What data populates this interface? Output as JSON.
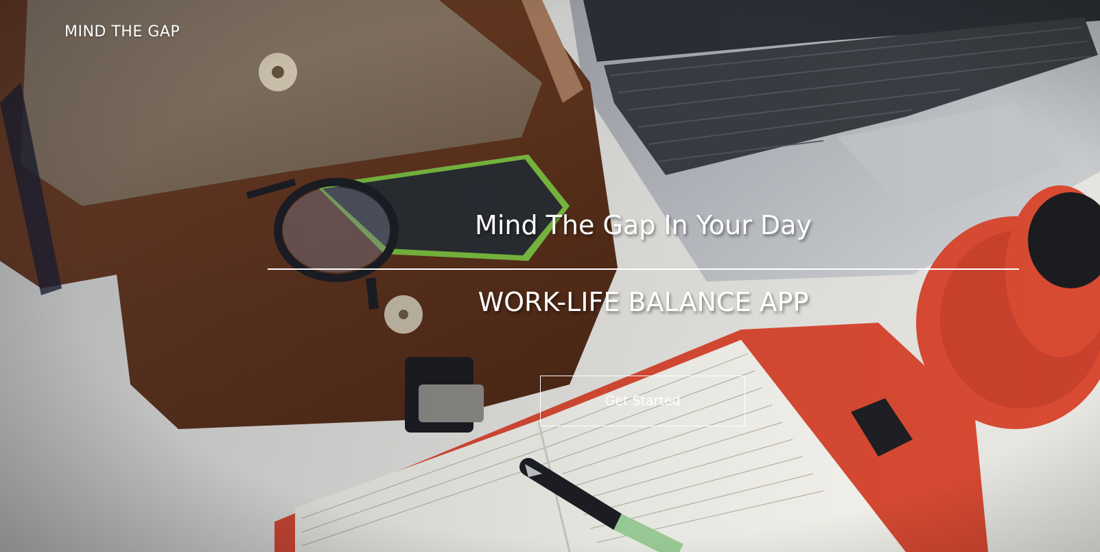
{
  "brand": {
    "name": "MIND THE GAP"
  },
  "hero": {
    "headline": "Mind The Gap In Your Day",
    "subheadline": "WORK-LIFE BALANCE APP",
    "cta_label": "Get Started"
  },
  "colors": {
    "text": "#ffffff",
    "desk": "#e6e4de",
    "bag_leather": "#6e3b1f",
    "bag_canvas": "#8f7a60",
    "laptop": "#b9bcc1",
    "keys": "#2b2d31",
    "accent_red": "#d94a32"
  }
}
